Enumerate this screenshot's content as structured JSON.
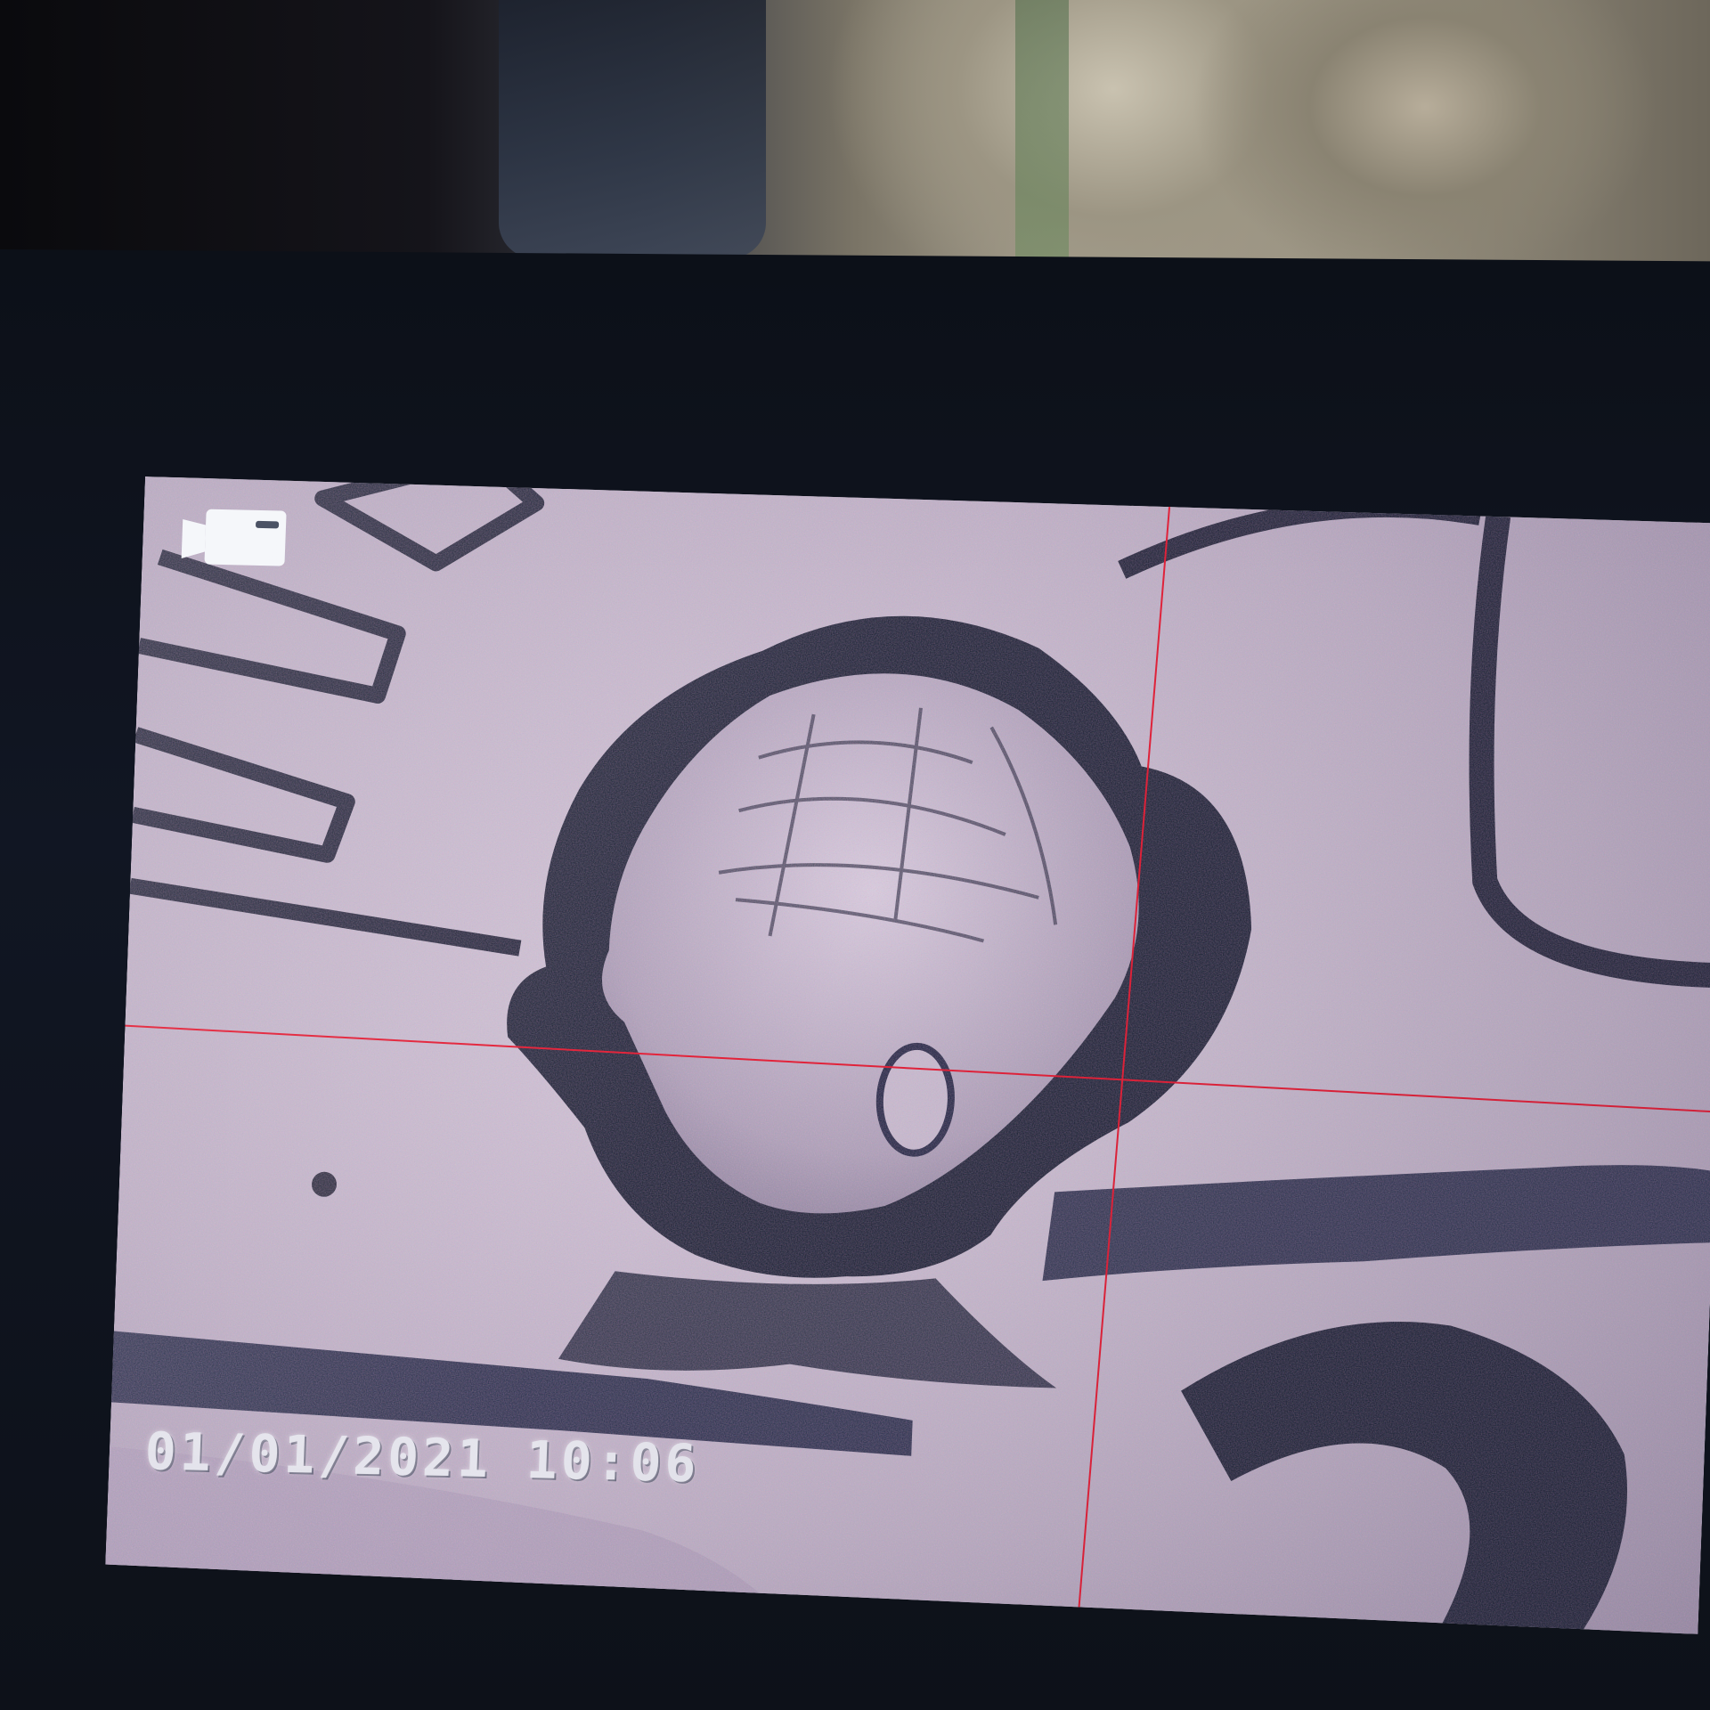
{
  "overlay": {
    "record_icon": "video-camera-icon",
    "timestamp": "01/01/2021 10:06",
    "crosshair_color": "#e3233a"
  },
  "subject": {
    "description_colors": {
      "coin_surface": "#b9b3c3",
      "relief_outline": "#0f1a2a"
    }
  }
}
